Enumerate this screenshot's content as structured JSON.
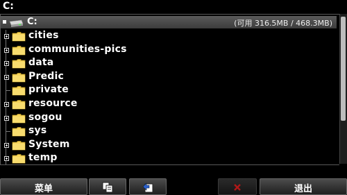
{
  "window": {
    "title": "C:"
  },
  "drive": {
    "label": "C:",
    "free_space": "(可用 316.5MB / 468.3MB)",
    "icon": "drive-icon"
  },
  "folders": [
    {
      "name": "cities",
      "expandable": true
    },
    {
      "name": "communities-pics",
      "expandable": true
    },
    {
      "name": "data",
      "expandable": true
    },
    {
      "name": "Predic",
      "expandable": true
    },
    {
      "name": "private",
      "expandable": false
    },
    {
      "name": "resource",
      "expandable": true
    },
    {
      "name": "sogou",
      "expandable": true
    },
    {
      "name": "sys",
      "expandable": false
    },
    {
      "name": "System",
      "expandable": true
    },
    {
      "name": "temp",
      "expandable": true
    }
  ],
  "toolbar": {
    "menu_label": "菜单",
    "copy_icon": "copy-icon",
    "move_icon": "move-icon",
    "delete_icon": "delete-x-icon",
    "exit_label": "退出"
  },
  "colors": {
    "background": "#000000",
    "folder": "#f5d35a",
    "drive_row": "#4a4a4a",
    "delete_x": "#c02020"
  }
}
